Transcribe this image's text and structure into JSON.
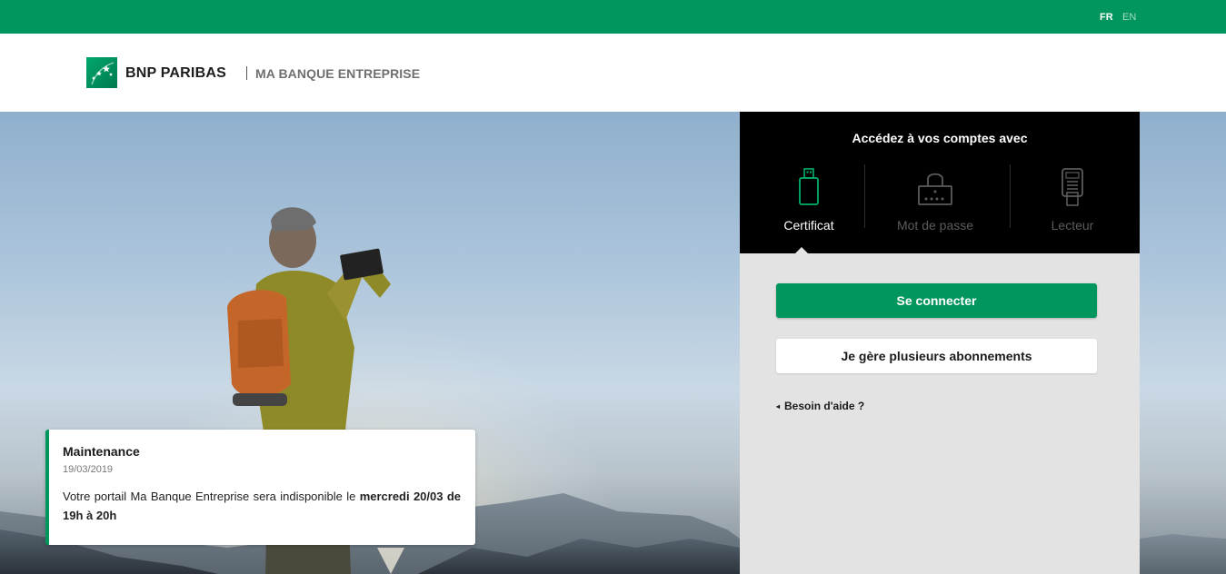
{
  "topbar": {
    "languages": [
      {
        "code": "FR",
        "active": true
      },
      {
        "code": "EN",
        "active": false
      }
    ]
  },
  "header": {
    "brand": "BNP PARIBAS",
    "product": "MA BANQUE ENTREPRISE",
    "logo_icon": "bnp-stars-logo-icon",
    "brand_color": "#00965e"
  },
  "notice": {
    "title": "Maintenance",
    "date": "19/03/2019",
    "text_plain": "Votre portail Ma Banque Entreprise sera indisponible le ",
    "text_bold": "mercredi 20/03 de 19h à 20h"
  },
  "login_panel": {
    "title": "Accédez à vos comptes avec",
    "tabs": [
      {
        "label": "Certificat",
        "icon": "usb-key-icon",
        "active": true
      },
      {
        "label": "Mot de passe",
        "icon": "padlock-icon",
        "active": false
      },
      {
        "label": "Lecteur",
        "icon": "card-reader-icon",
        "active": false
      }
    ],
    "connect_label": "Se connecter",
    "subscriptions_label": "Je gère plusieurs abonnements",
    "help_label": "Besoin d'aide ?"
  }
}
